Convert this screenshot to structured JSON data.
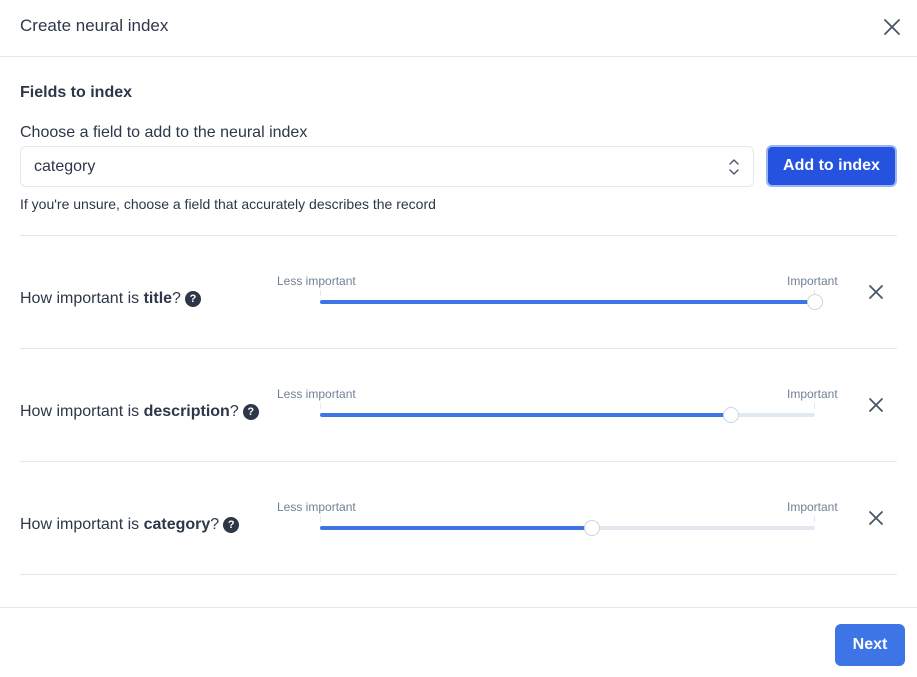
{
  "dialog": {
    "title": "Create neural index",
    "close_icon": "close-icon"
  },
  "fields": {
    "section_title": "Fields to index",
    "choose_label": "Choose a field to add to the neural index",
    "select_value": "category",
    "add_button": "Add to index",
    "help_text": "If you're unsure, choose a field that accurately describes the record"
  },
  "importance": {
    "question_prefix": "How important is ",
    "question_suffix": "?",
    "less_label": "Less important",
    "more_label": "Important",
    "rows": [
      {
        "field": "title",
        "value": 1.0
      },
      {
        "field": "description",
        "value": 0.83
      },
      {
        "field": "category",
        "value": 0.55
      }
    ]
  },
  "footer": {
    "next_button": "Next"
  },
  "colors": {
    "primary": "#2553e0",
    "slider_fill": "#3d74e6",
    "text": "#2d3748",
    "muted": "#718096",
    "border": "#e2e8f0"
  }
}
